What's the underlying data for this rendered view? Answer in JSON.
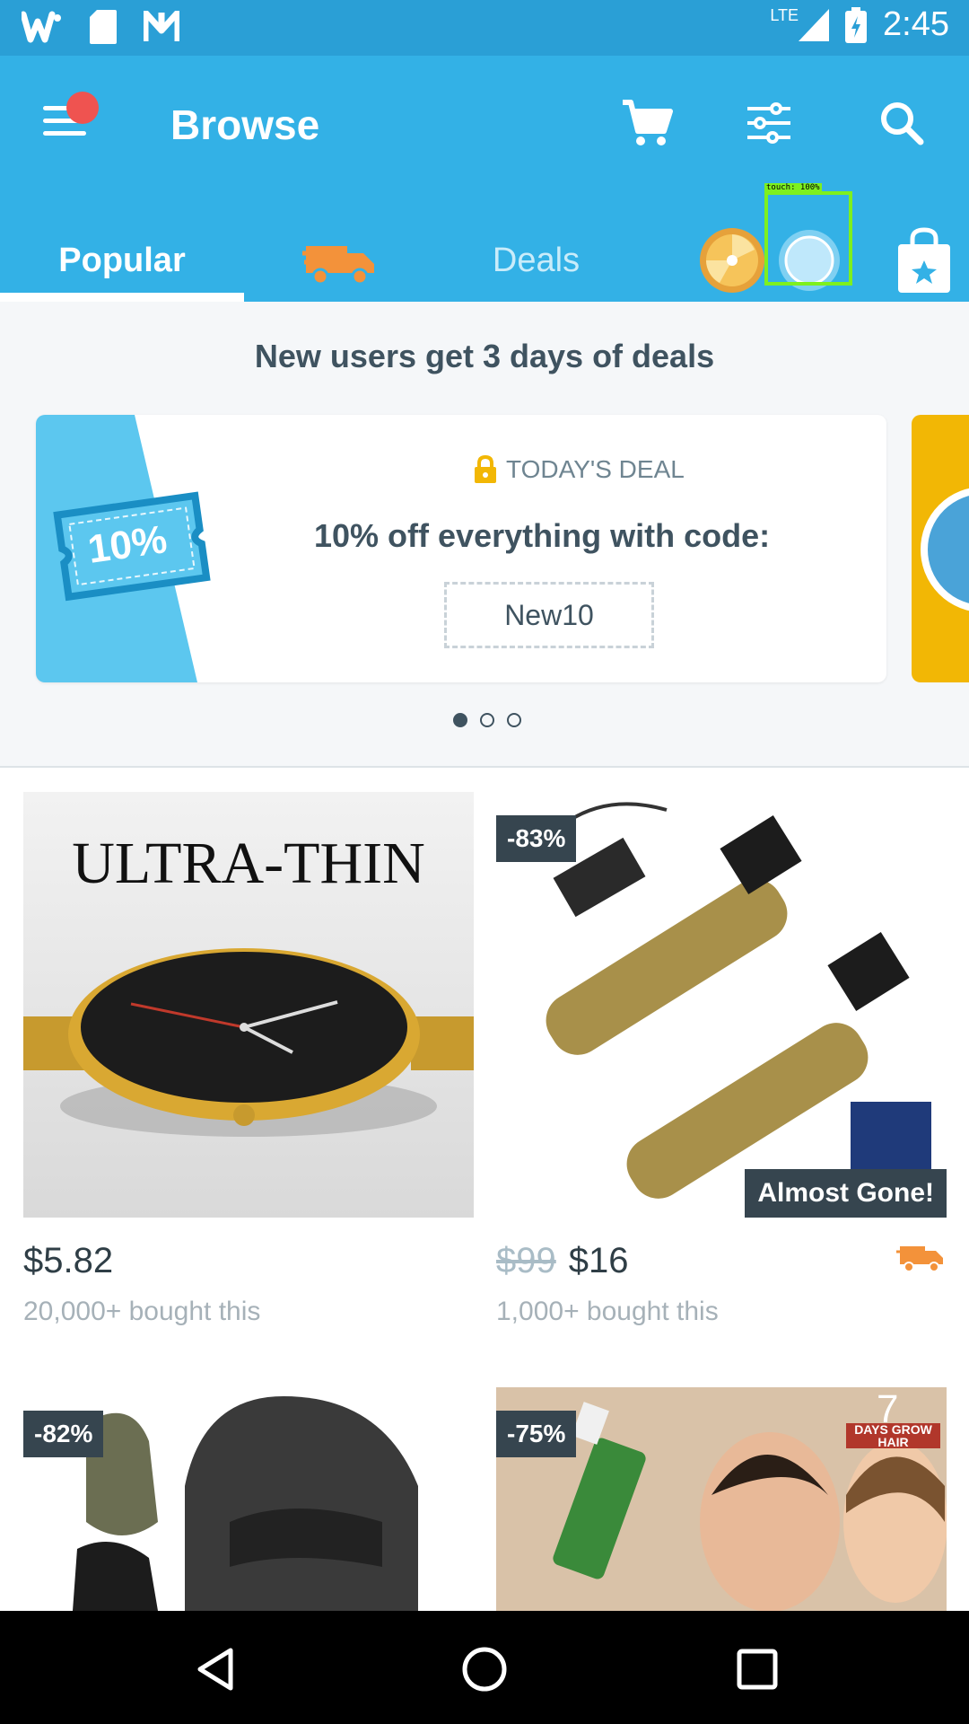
{
  "status_bar": {
    "time": "2:45",
    "network": "LTE"
  },
  "app_bar": {
    "title": "Browse"
  },
  "tabs": [
    {
      "label": "Popular",
      "active": true
    },
    {
      "label": "Deals",
      "active": false
    }
  ],
  "promo": {
    "title": "New users get 3 days of deals",
    "coupon_text": "10%",
    "deal_label": "TODAY'S DEAL",
    "deal_text": "10% off everything with code:",
    "code": "New10",
    "carousel_pages": 3,
    "carousel_active": 1
  },
  "products": [
    {
      "image_text": "ULTRA-THIN",
      "price": "$5.82",
      "old_price": "",
      "badge": "",
      "bought": "20,000+ bought this"
    },
    {
      "image_text": "",
      "price": "$16",
      "old_price": "$99",
      "badge": "-83%",
      "tag": "Almost Gone!",
      "bought": "1,000+ bought this"
    },
    {
      "badge": "-82%"
    },
    {
      "badge": "-75%",
      "image_text": "7",
      "image_subtext": "DAYS GROW HAIR"
    }
  ],
  "overlay": {
    "touch_label": "touch: 100%"
  },
  "colors": {
    "primary": "#33b1e6",
    "status": "#2a9fd6",
    "orange": "#f3923a"
  }
}
